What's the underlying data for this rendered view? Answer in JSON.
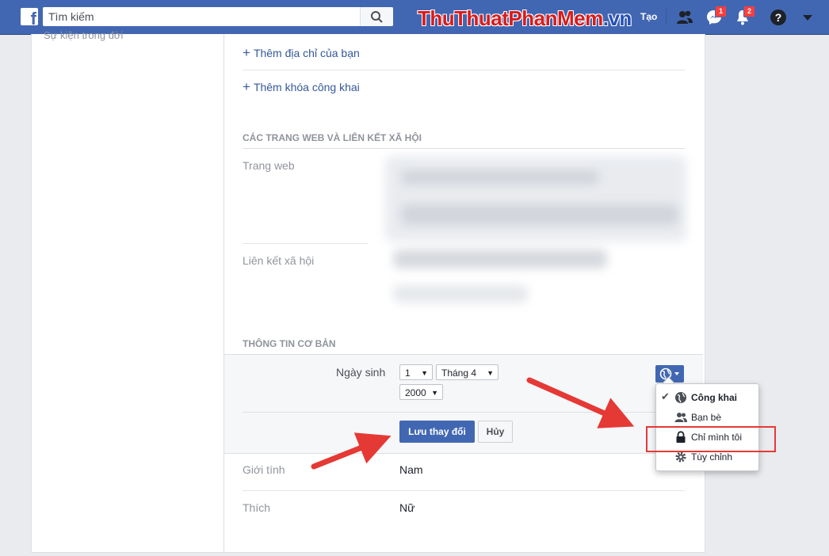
{
  "topbar": {
    "search_placeholder": "Tìm kiếm",
    "watermark": {
      "part1": "ThuThuat",
      "part2": "PhanMem",
      "part3": ".vn"
    },
    "create_label": "Tạo",
    "messages_badge": "1",
    "notifications_badge": "2"
  },
  "left": {
    "faded_text": "Sự kiện trong đời"
  },
  "contact": {
    "add_address": "Thêm địa chỉ của bạn",
    "add_public_key": "Thêm khóa công khai"
  },
  "websites": {
    "heading": "CÁC TRANG WEB VÀ LIÊN KẾT XÃ HỘI",
    "website_label": "Trang web",
    "social_label": "Liên kết xã hội"
  },
  "basic_info": {
    "heading": "THÔNG TIN CƠ BẢN",
    "dob_label": "Ngày sinh",
    "day": "1",
    "month": "Tháng 4",
    "year": "2000",
    "save_label": "Lưu thay đổi",
    "cancel_label": "Hủy",
    "gender_label": "Giới tính",
    "gender_value": "Nam",
    "interest_label": "Thích",
    "interest_value": "Nữ"
  },
  "privacy_menu": {
    "items": [
      {
        "label": "Công khai",
        "icon": "globe-icon",
        "selected": true
      },
      {
        "label": "Bạn bè",
        "icon": "friends-icon",
        "selected": false
      },
      {
        "label": "Chỉ mình tôi",
        "icon": "lock-icon",
        "selected": false
      },
      {
        "label": "Tùy chỉnh",
        "icon": "gear-icon",
        "selected": false
      }
    ]
  },
  "colors": {
    "brand": "#4267b2",
    "link": "#365899",
    "annotation": "#e53935"
  }
}
